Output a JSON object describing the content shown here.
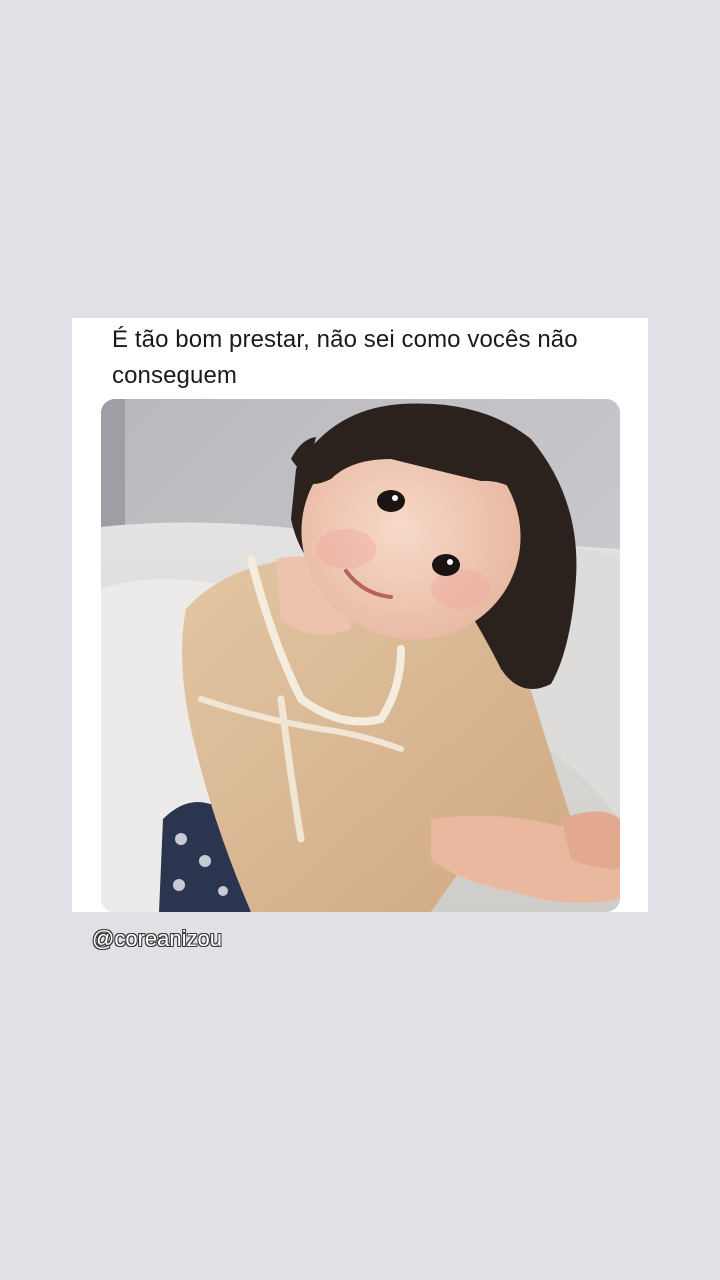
{
  "story": {
    "background_color": "#e1e0e6",
    "post": {
      "text": "É tão bom prestar, não sei como vocês não conseguem",
      "photo_icon": "child-photo"
    },
    "username_tag": "@coreanizou"
  }
}
